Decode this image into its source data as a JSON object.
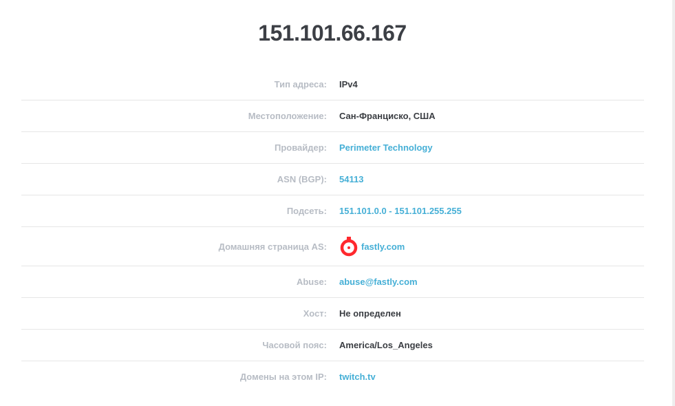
{
  "title": "151.101.66.167",
  "rows": [
    {
      "label": "Тип адреса:",
      "value": "IPv4"
    },
    {
      "label": "Местоположение:",
      "value": "Сан-Франциско, США"
    },
    {
      "label": "Провайдер:",
      "value": "Perimeter Technology"
    },
    {
      "label": "ASN (BGP):",
      "value": "54113"
    },
    {
      "label": "Подсеть:",
      "value": "151.101.0.0 - 151.101.255.255"
    },
    {
      "label": "Домашняя страница AS:",
      "value": "fastly.com",
      "icon": "fastly-logo-icon"
    },
    {
      "label": "Abuse:",
      "value": "abuse@fastly.com"
    },
    {
      "label": "Хост:",
      "value": "Не определен"
    },
    {
      "label": "Часовой пояс:",
      "value": "America/Los_Angeles"
    },
    {
      "label": "Домены на этом IP:",
      "value": "twitch.tv"
    }
  ],
  "colors": {
    "title": "#3c3f45",
    "label": "#b7bcc4",
    "value": "#3a3d42",
    "link": "#45afd6",
    "logo": "#ff282d"
  }
}
